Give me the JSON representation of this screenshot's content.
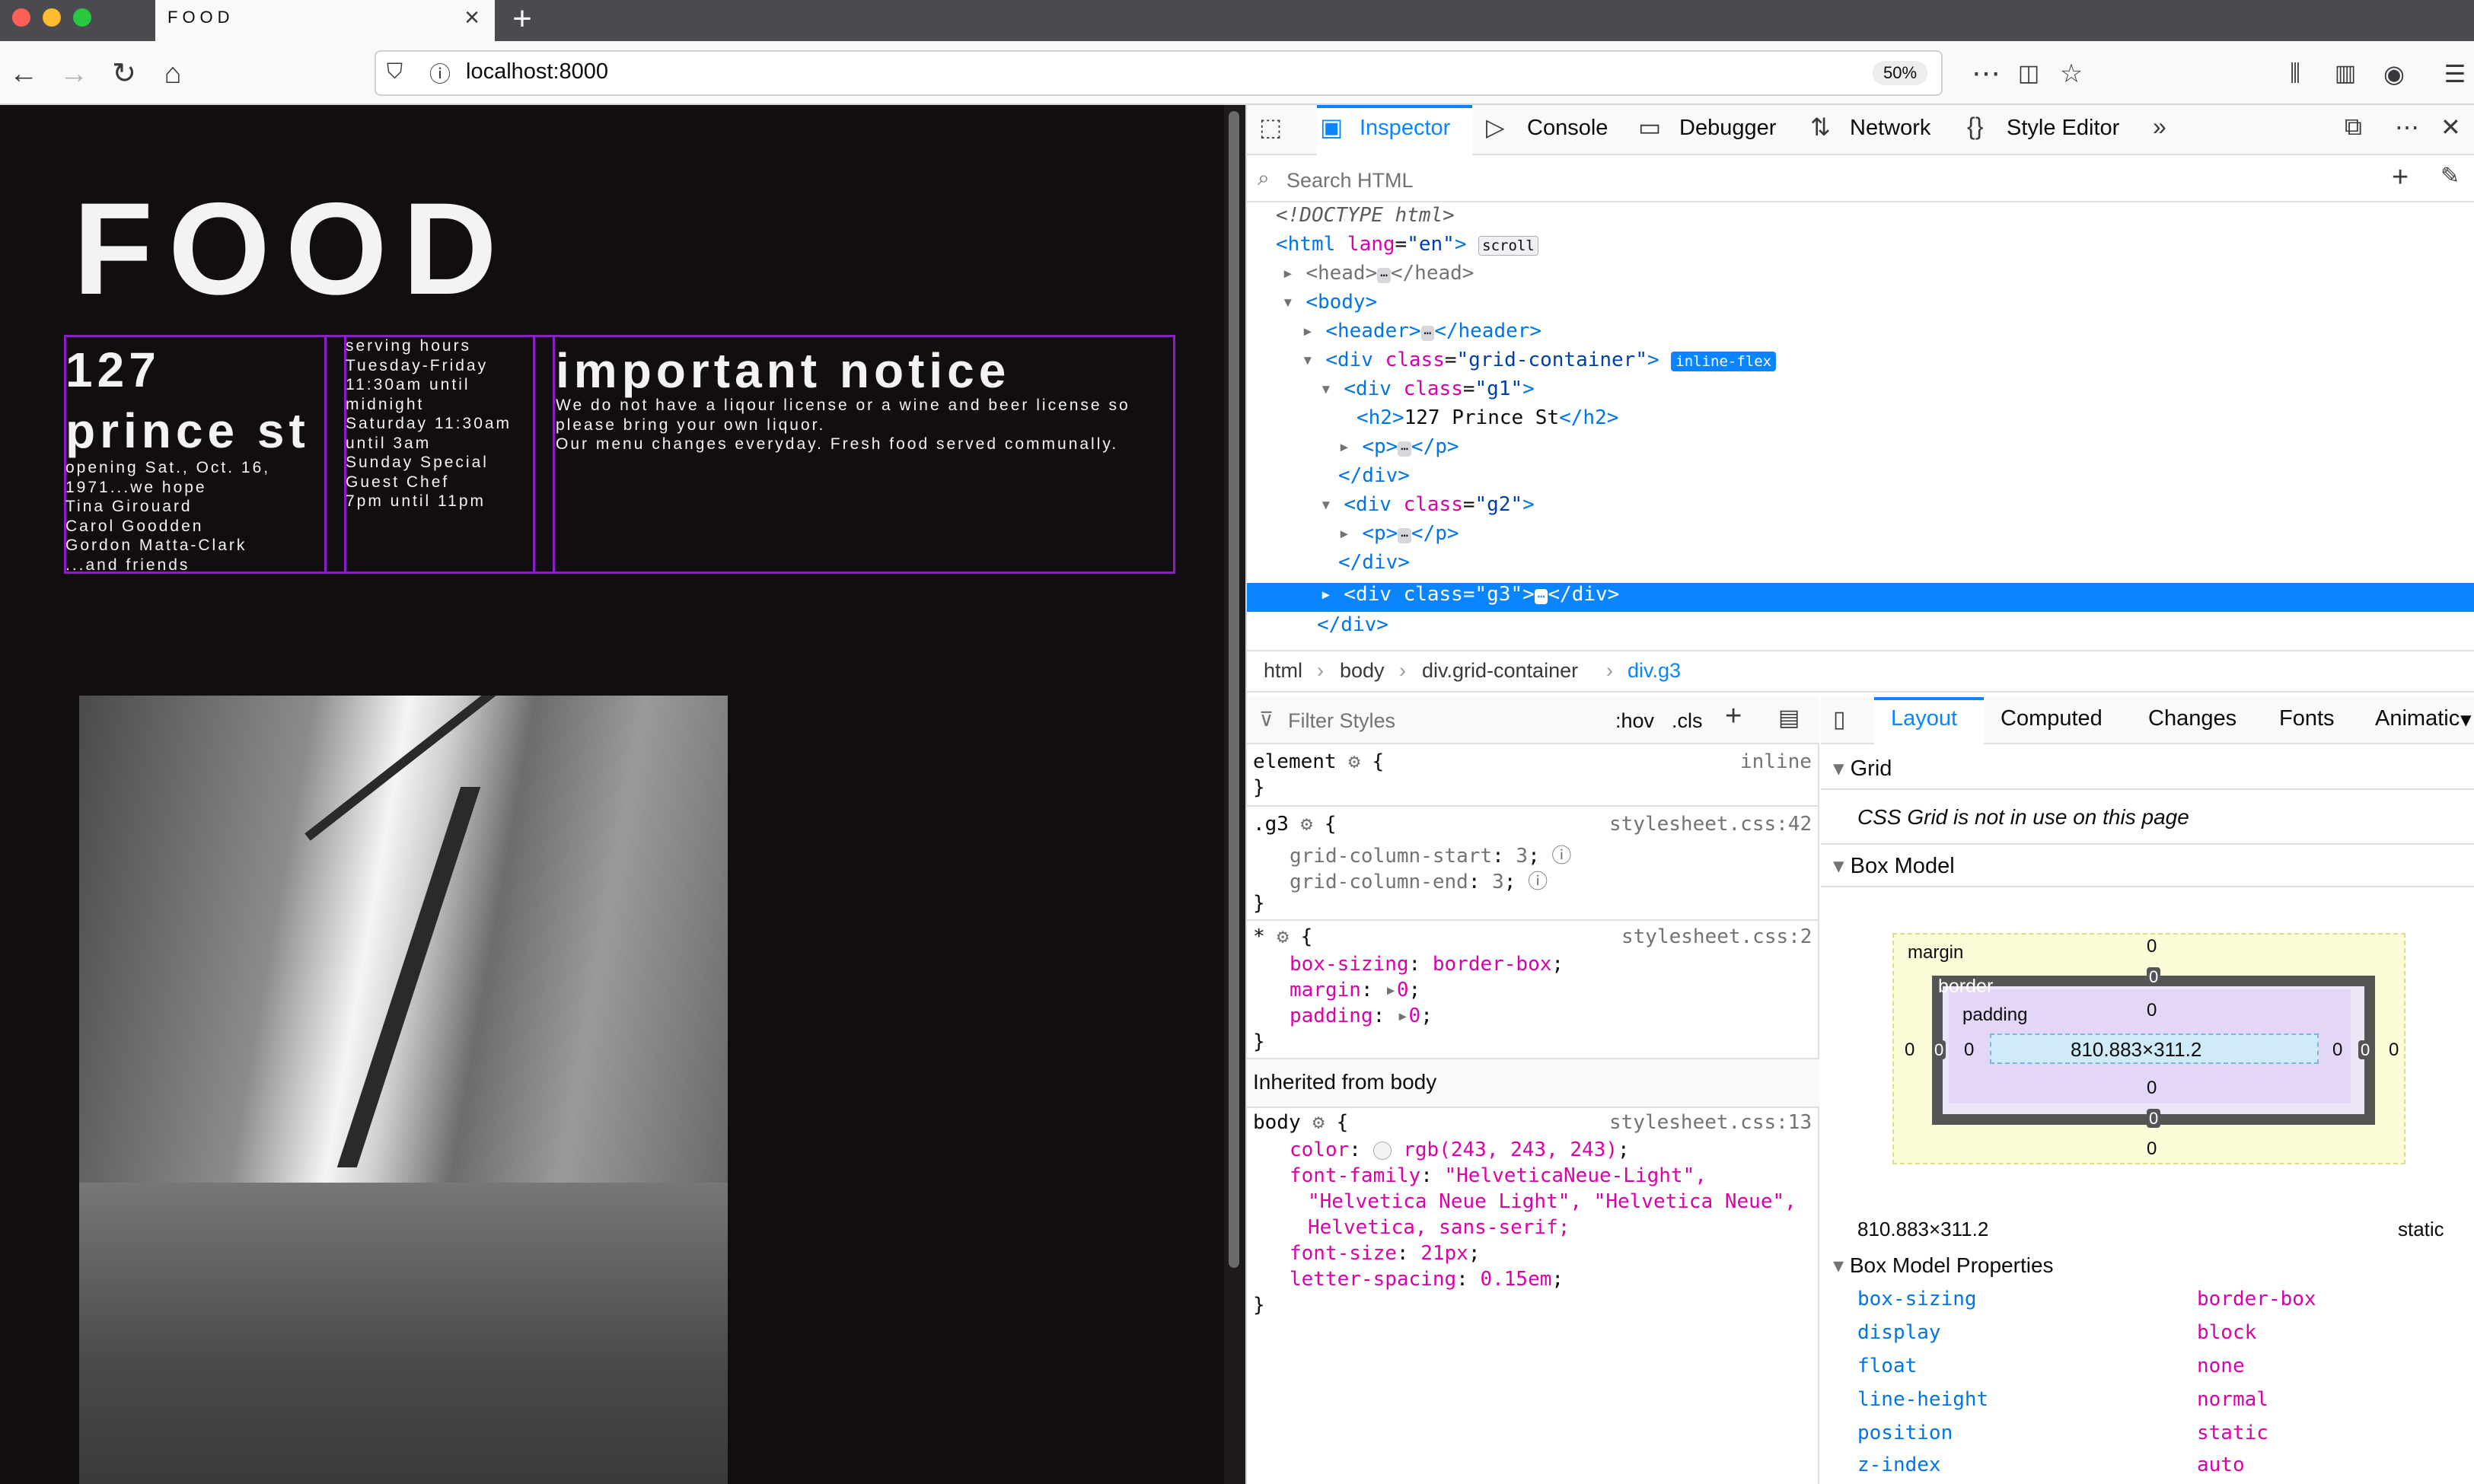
{
  "browser": {
    "tab_title": "FOOD",
    "url": "localhost:8000",
    "zoom": "50%"
  },
  "page": {
    "title": "FOOD",
    "g1_heading": "127\nprince st",
    "g1_text": "opening Sat., Oct. 16,\n1971...we hope\nTina Girouard\nCarol Goodden\nGordon Matta-Clark\n...and friends",
    "g2_text": "serving hours\nTuesday-Friday\n11:30am until\nmidnight\nSaturday 11:30am\nuntil 3am\nSunday Special\nGuest Chef\n7pm until 11pm",
    "g3_heading": "important notice",
    "g3_text": "We do not have a liqour license or a wine and beer license so\nplease bring your own liquor.\nOur menu changes everyday. Fresh food served communally."
  },
  "devtools": {
    "tabs": [
      "Inspector",
      "Console",
      "Debugger",
      "Network",
      "Style Editor"
    ],
    "search_placeholder": "Search HTML",
    "html_tree": {
      "doctype": "<!DOCTYPE html>",
      "scroll_badge": "scroll",
      "inline_flex_badge": "inline-flex"
    },
    "breadcrumbs": [
      "html",
      "body",
      "div.grid-container",
      "div.g3"
    ],
    "rules": {
      "filter_placeholder": "Filter Styles",
      "hov": ":hov",
      "cls": ".cls",
      "element_label": "element",
      "element_src": "inline",
      "g3_selector": ".g3",
      "g3_src": "stylesheet.css:42",
      "g3_props": [
        [
          "grid-column-start",
          "3"
        ],
        [
          "grid-column-end",
          "3"
        ]
      ],
      "star_src": "stylesheet.css:2",
      "star_props": [
        [
          "box-sizing",
          "border-box"
        ],
        [
          "margin",
          "0"
        ],
        [
          "padding",
          "0"
        ]
      ],
      "inherited_label": "Inherited from body",
      "body_src": "stylesheet.css:13",
      "body_color": "rgb(243, 243, 243)",
      "body_font_family_1": "\"HelveticaNeue-Light\",",
      "body_font_family_2": "\"Helvetica Neue Light\", \"Helvetica Neue\",",
      "body_font_family_3": "Helvetica, sans-serif;",
      "body_font_size": "21px",
      "body_letter_spacing": "0.15em"
    },
    "layout": {
      "tabs": [
        "Layout",
        "Computed",
        "Changes",
        "Fonts",
        "Animatic"
      ],
      "grid_heading": "Grid",
      "grid_note": "CSS Grid is not in use on this page",
      "box_model_heading": "Box Model",
      "margin_label": "margin",
      "border_label": "border",
      "padding_label": "padding",
      "content_size": "810.883×311.2",
      "zero": "0",
      "size_readout": "810.883×311.2",
      "position_readout": "static",
      "props_heading": "Box Model Properties",
      "props": [
        [
          "box-sizing",
          "border-box"
        ],
        [
          "display",
          "block"
        ],
        [
          "float",
          "none"
        ],
        [
          "line-height",
          "normal"
        ],
        [
          "position",
          "static"
        ],
        [
          "z-index",
          "auto"
        ]
      ]
    }
  }
}
